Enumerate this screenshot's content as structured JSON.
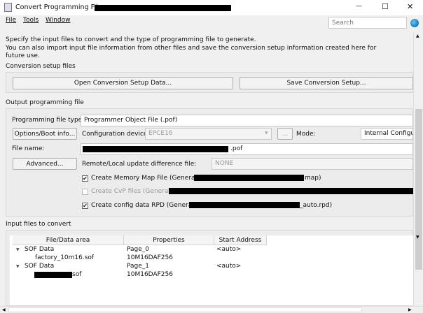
{
  "window": {
    "title": "Convert Programming File - ",
    "minimize": "—",
    "maximize": "☐",
    "close": "✕"
  },
  "menu": [
    "File",
    "Tools",
    "Window"
  ],
  "search": {
    "placeholder": "Search"
  },
  "description": [
    "Specify the input files to convert and the type of programming file to generate.",
    "You can also import input file information from other files and save the conversion setup information created here for",
    "future use."
  ],
  "setup": {
    "heading": "Conversion setup files",
    "open": "Open Conversion Setup Data...",
    "save": "Save Conversion Setup..."
  },
  "output": {
    "heading": "Output programming file",
    "type_label": "Programming file type:",
    "type_value": "Programmer Object File (.pof)",
    "options_btn": "Options/Boot info...",
    "device_label": "Configuration device:",
    "device_value": "EPCE16",
    "browse": "...",
    "mode_label": "Mode:",
    "mode_value": "Internal Configuration",
    "file_label": "File name:",
    "file_suffix": ".pof",
    "advanced_btn": "Advanced...",
    "diff_label": "Remote/Local update difference file:",
    "diff_value": "NONE",
    "map_label": "Create Memory Map File (Generate ",
    "map_suffix": "map)",
    "cvp_label": "Create CvP files (Generate ",
    "rpd_label": "Create config data RPD (Generate ",
    "rpd_suffix": "_auto.rpd)"
  },
  "input": {
    "heading": "Input files to convert",
    "columns": [
      "File/Data area",
      "Properties",
      "Start Address"
    ],
    "rows": [
      {
        "name": "SOF Data",
        "prop": "Page_0",
        "addr": "<auto>"
      },
      {
        "name": "factory_10m16.sof",
        "prop": "10M16DAF256",
        "addr": ""
      },
      {
        "name": "SOF Data",
        "prop": "Page_1",
        "addr": "<auto>"
      },
      {
        "name": "sof",
        "prop": "10M16DAF256",
        "addr": ""
      }
    ]
  }
}
